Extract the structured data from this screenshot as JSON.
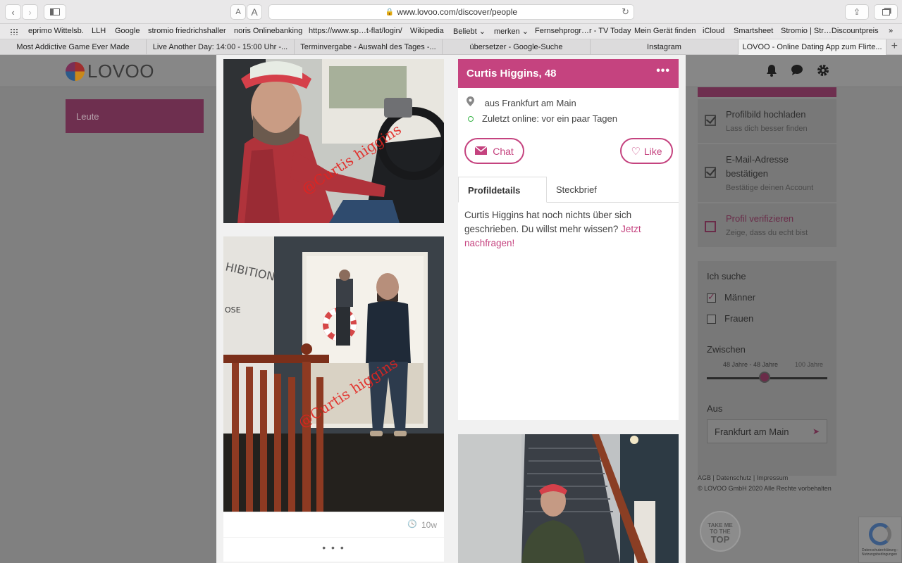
{
  "browser": {
    "url": "www.lovoo.com/discover/people",
    "font_small": "A",
    "font_large": "A"
  },
  "bookmarks": [
    "eprimo Wittelsb.",
    "LLH",
    "Google",
    "stromio friedrichshaller",
    "noris Onlinebanking",
    "https://www.sp…t-flat/login/",
    "Wikipedia",
    "Beliebt ⌄",
    "merken ⌄",
    "Fernsehprogr…r - TV Today",
    "Mein Gerät finden",
    "iCloud",
    "Smartsheet",
    "Stromio | Str…Discountpreis",
    "»"
  ],
  "tabs": [
    {
      "label": "Most Addictive Game Ever Made",
      "active": false
    },
    {
      "label": "Live Another Day: 14:00 - 15:00 Uhr -...",
      "active": false
    },
    {
      "label": "Terminvergabe - Auswahl des Tages -...",
      "active": false
    },
    {
      "label": "übersetzer - Google-Suche",
      "active": false
    },
    {
      "label": "Instagram",
      "active": false
    },
    {
      "label": "LOVOO - Online Dating App zum Flirte...",
      "active": true
    }
  ],
  "site": {
    "logo_text": "LOVOO",
    "nav_leute": "Leute"
  },
  "tasks": [
    {
      "title": "Profilbild hochladen",
      "subtitle": "Lass dich besser finden",
      "done": true
    },
    {
      "title": "E-Mail-Adresse bestätigen",
      "subtitle": "Bestätige deinen Account",
      "done": true
    },
    {
      "title": "Profil verifizieren",
      "subtitle": "Zeige, dass du echt bist",
      "done": false
    }
  ],
  "search": {
    "ich_suche": "Ich suche",
    "option_men": "Männer",
    "option_women": "Frauen",
    "men_checked": true,
    "women_checked": false,
    "zwischen": "Zwischen",
    "range_label": "48 Jahre - 48 Jahre",
    "range_max_label": "100 Jahre",
    "range_value": 48,
    "range_max": 100,
    "aus": "Aus",
    "city": "Frankfurt am Main"
  },
  "footer": {
    "links": "AGB | Datenschutz | Impressum",
    "copyright": "© LOVOO GmbH 2020 Alle Rechte vorbehalten"
  },
  "to_top": {
    "line1": "TAKE ME",
    "line2": "TO THE",
    "line3": "TOP"
  },
  "captcha_text": "Datenschutzerklärung - Nutzungsbedingungen",
  "profile": {
    "name": "Curtis Higgins, 48",
    "location": "aus Frankfurt am Main",
    "last_online": "Zuletzt online: vor ein paar Tagen",
    "chat_label": "Chat",
    "like_label": "Like",
    "tab_details": "Profildetails",
    "tab_steckbrief": "Steckbrief",
    "about_text": "Curtis Higgins hat noch nichts über sich geschrieben. Du willst mehr wissen?",
    "about_link": "Jetzt nachfragen!",
    "photo_age": "10w",
    "watermark": "@Curtis higgins",
    "more": "• • •"
  },
  "colors": {
    "accent": "#c5437f",
    "online": "#3bb54a"
  }
}
